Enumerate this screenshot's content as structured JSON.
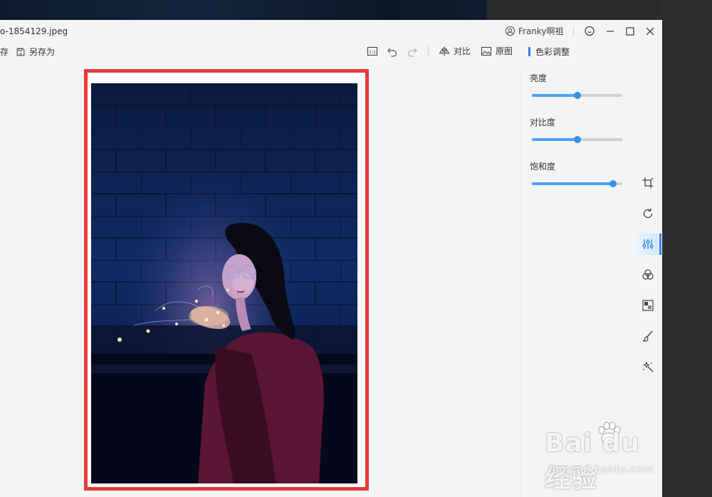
{
  "window": {
    "filename": "o-1854129.jpeg",
    "user_name": "Franky啊祖"
  },
  "toolbar": {
    "save_label": "存",
    "save_as_label": "另存为",
    "ratio_label": "1:1",
    "compare_label": "对比",
    "original_label": "原图"
  },
  "panel": {
    "title": "色彩调整",
    "sliders": [
      {
        "label": "亮度",
        "value": 0.5
      },
      {
        "label": "对比度",
        "value": 0.5
      },
      {
        "label": "饱和度",
        "value": 0.9
      }
    ]
  },
  "tools": [
    "crop-icon",
    "rotate-icon",
    "adjust-icon",
    "filter-icon",
    "mosaic-icon",
    "brush-icon",
    "magic-icon"
  ],
  "watermark": {
    "main": "Bai du 经验",
    "sub": "jingyan.baidu.com"
  },
  "colors": {
    "accent": "#2f80ed",
    "slider_fill": "#4aa3f5",
    "frame_highlight": "#e63b3b"
  }
}
